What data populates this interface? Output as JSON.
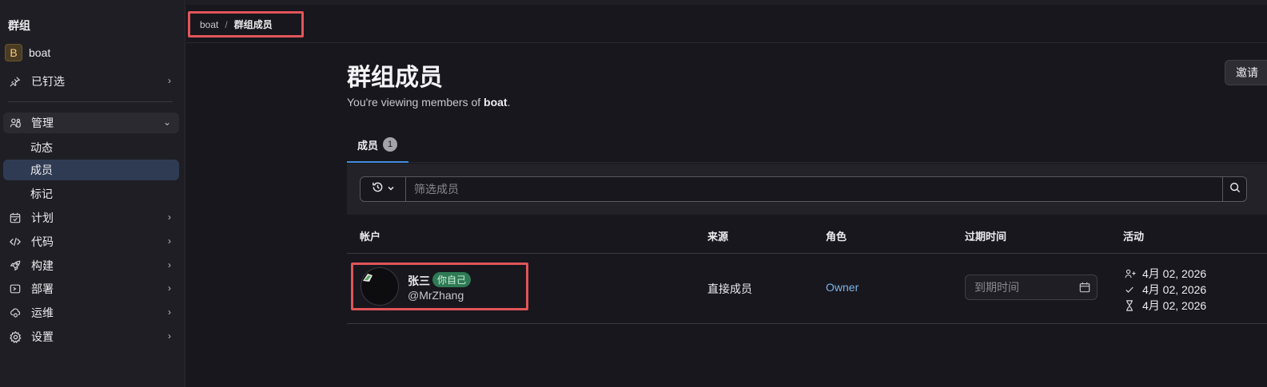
{
  "sidebar": {
    "header": "群组",
    "group": {
      "initial": "B",
      "name": "boat"
    },
    "pinned": "已钉选",
    "manage": "管理",
    "manage_items": [
      "动态",
      "成员",
      "标记"
    ],
    "items": [
      {
        "label": "计划",
        "icon": "calendar-icon"
      },
      {
        "label": "代码",
        "icon": "code-icon"
      },
      {
        "label": "构建",
        "icon": "rocket-icon"
      },
      {
        "label": "部署",
        "icon": "deploy-icon"
      },
      {
        "label": "运维",
        "icon": "cloud-monitor-icon"
      },
      {
        "label": "设置",
        "icon": "gear-icon"
      }
    ]
  },
  "breadcrumb": {
    "root": "boat",
    "separator": "/",
    "current": "群组成员"
  },
  "page": {
    "title": "群组成员",
    "subtitle_prefix": "You're viewing members of ",
    "subtitle_group": "boat",
    "subtitle_suffix": ".",
    "invite_button": "邀请"
  },
  "tabs": [
    {
      "label": "成员",
      "count": "1"
    }
  ],
  "filter": {
    "placeholder": "筛选成员"
  },
  "table": {
    "headers": [
      "帐户",
      "来源",
      "角色",
      "过期时间",
      "活动"
    ],
    "rows": [
      {
        "name": "张三",
        "badge": "你自己",
        "username": "@MrZhang",
        "source": "直接成员",
        "role": "Owner",
        "expiry_placeholder": "到期时间",
        "activity": {
          "access_granted": "4月 02, 2026",
          "user_created": "4月 02, 2026",
          "last_activity": "4月 02, 2026"
        }
      }
    ]
  },
  "colors": {
    "accent": "#428fdc",
    "highlight_box": "#e05559",
    "badge_green": "#2f7a55",
    "role_link": "#7bb4ec"
  }
}
